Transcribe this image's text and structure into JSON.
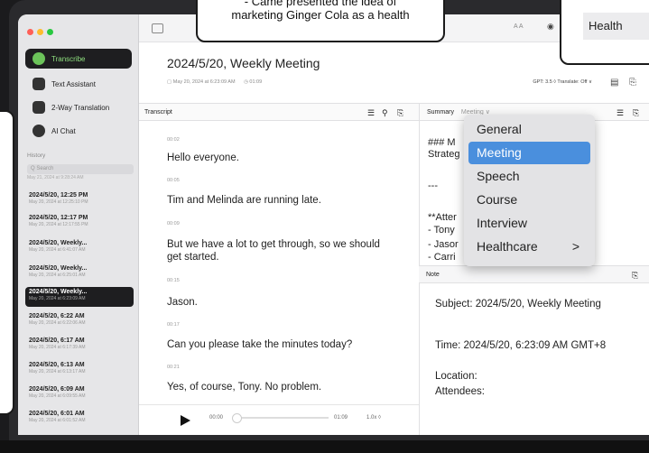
{
  "sidebar": {
    "nav": [
      {
        "label": "Transcribe",
        "icon": "transcribe-icon"
      },
      {
        "label": "Text Assistant",
        "icon": "text-assistant-icon"
      },
      {
        "label": "2-Way Translation",
        "icon": "translation-icon"
      },
      {
        "label": "AI Chat",
        "icon": "chat-icon"
      }
    ],
    "history_label": "History",
    "search_placeholder": "Search",
    "search_date": "May 21, 2024 at 9:28:24 AM",
    "history": [
      {
        "title": "2024/5/20, 12:25 PM",
        "date": "May 20, 2024 at 12:25:10 PM"
      },
      {
        "title": "2024/5/20, 12:17 PM",
        "date": "May 20, 2024 at 12:17:55 PM"
      },
      {
        "title": "2024/5/20, Weekly...",
        "date": "May 20, 2024 at 6:41:07 AM"
      },
      {
        "title": "2024/5/20, Weekly...",
        "date": "May 20, 2024 at 6:25:01 AM"
      },
      {
        "title": "2024/5/20, Weekly...",
        "date": "May 20, 2024 at 6:23:09 AM"
      },
      {
        "title": "2024/5/20, 6:22 AM",
        "date": "May 20, 2024 at 6:22:06 AM"
      },
      {
        "title": "2024/5/20, 6:17 AM",
        "date": "May 20, 2024 at 6:17:39 AM"
      },
      {
        "title": "2024/5/20, 6:13 AM",
        "date": "May 20, 2024 at 6:13:17 AM"
      },
      {
        "title": "2024/5/20, 6:09 AM",
        "date": "May 20, 2024 at 6:09:55 AM"
      },
      {
        "title": "2024/5/20, 6:01 AM",
        "date": "May 20, 2024 at 6:01:52 AM"
      }
    ]
  },
  "main": {
    "title": "2024/5/20, Weekly Meeting",
    "date": "May 20, 2024 at 6:23:09 AM",
    "duration": "01:09",
    "gpt_translate": "GPT: 3.5 ◊  Translate: Off ∨",
    "window_letters": "A   A",
    "transcript_label": "Transcript",
    "summary_label": "Summary",
    "summary_template": "Meeting ∨",
    "note_label": "Note"
  },
  "transcript": [
    {
      "time": "00:02",
      "text": "Hello everyone."
    },
    {
      "time": "00:05",
      "text": "Tim and Melinda are running late."
    },
    {
      "time": "00:09",
      "text": "But we have a lot to get through, so we should get started."
    },
    {
      "time": "00:15",
      "text": "Jason."
    },
    {
      "time": "00:17",
      "text": "Can you please take the minutes today?"
    },
    {
      "time": "00:21",
      "text": "Yes, of course, Tony. No problem."
    }
  ],
  "summary_lines": [
    "### M",
    "Strateg",
    "---",
    "**Atter",
    "- Tony",
    "- Jasor",
    "- Carri"
  ],
  "note": {
    "subject": "Subject: 2024/5/20, Weekly Meeting",
    "time": "Time: 2024/5/20, 6:23:09 AM GMT+8",
    "location": "Location:",
    "attendees": "Attendees:"
  },
  "player": {
    "current": "00:00",
    "total": "01:09",
    "speed": "1.0x ◊"
  },
  "menu": {
    "items": [
      "General",
      "Meeting",
      "Speech",
      "Course",
      "Interview",
      "Healthcare"
    ],
    "selected": "Meeting",
    "submenu_arrow": ">"
  },
  "callouts": {
    "top_line1": "- Came presented the idea of",
    "top_line2": "marketing Ginger Cola as a health",
    "right_text": "Health"
  },
  "colors": {
    "accent": "#4a8fdd",
    "active_nav_bg": "#1e1e20",
    "active_nav_text": "#8fe07f"
  }
}
